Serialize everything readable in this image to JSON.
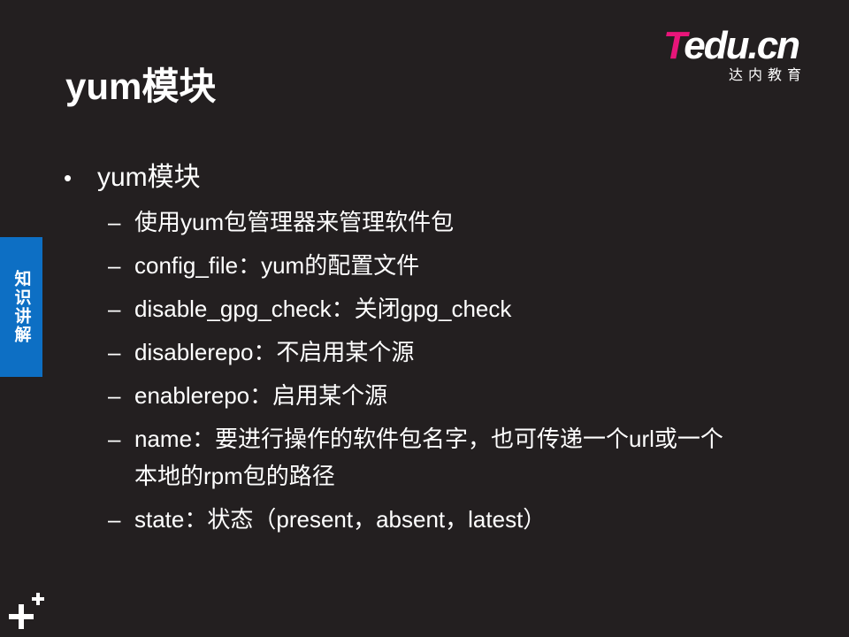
{
  "slide": {
    "title": "yum模块",
    "side_tab_label": "知识讲解"
  },
  "logo": {
    "brand_t": "T",
    "brand_rest": "edu.cn",
    "subtitle": "达内教育"
  },
  "content": {
    "bullet_symbol": "•",
    "main_bullet": "yum模块",
    "dash_symbol": "–",
    "sub_items": [
      "使用yum包管理器来管理软件包",
      "config_file：yum的配置文件",
      "disable_gpg_check：关闭gpg_check",
      "disablerepo：不启用某个源",
      "enablerepo：启用某个源",
      "name：要进行操作的软件包名字，也可传递一个url或一个本地的rpm包的路径",
      "state：状态（present，absent，latest）"
    ]
  },
  "colors": {
    "background": "#231f20",
    "accent_blue": "#0d6fc4",
    "brand_pink": "#e8157a",
    "text": "#ffffff"
  },
  "icons": {
    "corner_plus": "plus-icon"
  }
}
